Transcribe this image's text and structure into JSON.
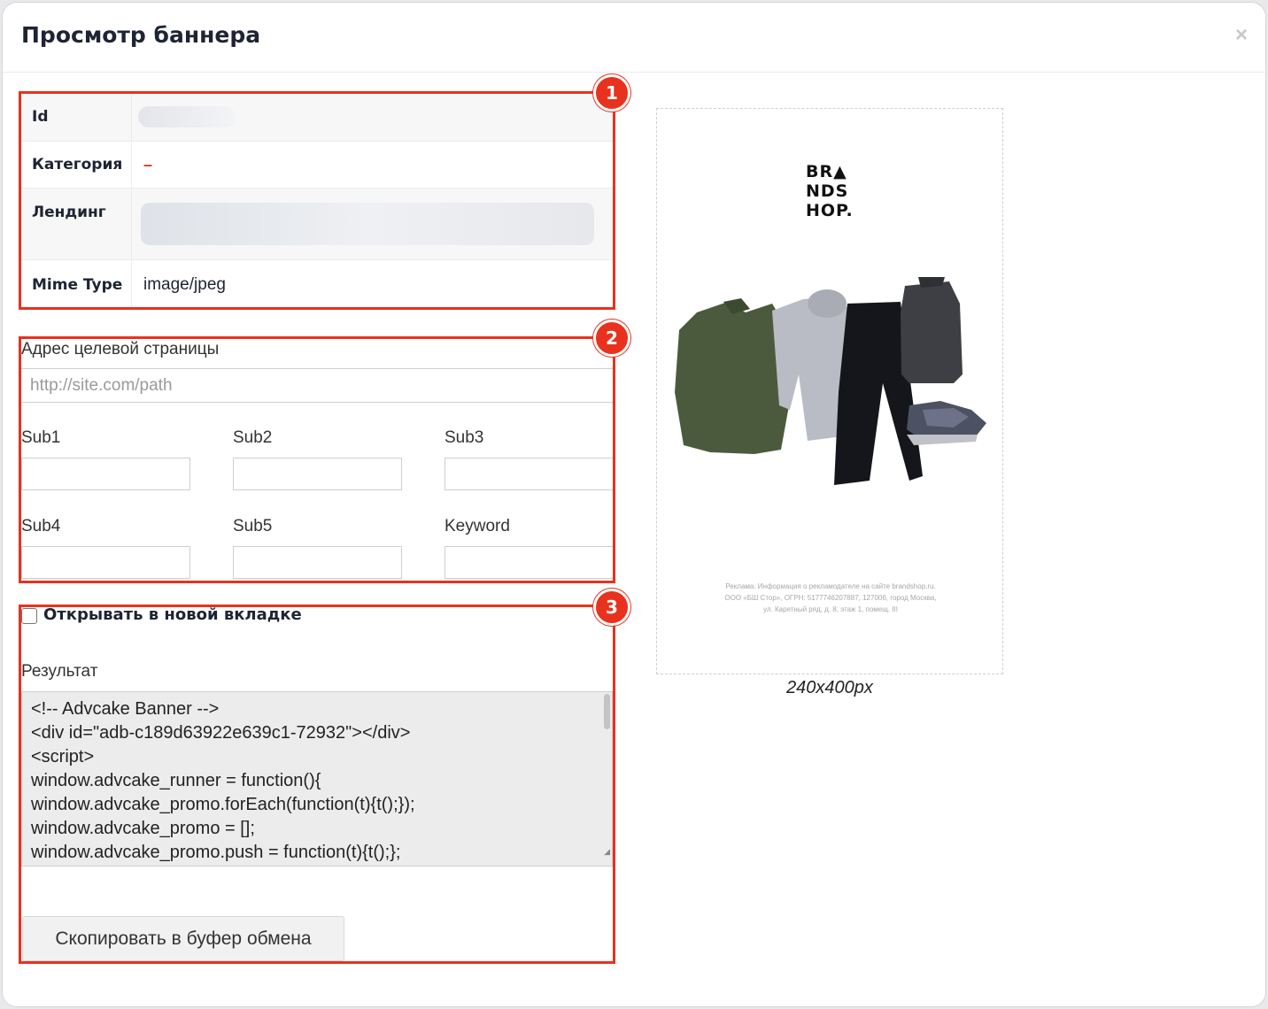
{
  "modal": {
    "title": "Просмотр баннера",
    "close_icon": "×"
  },
  "info": {
    "id_label": "Id",
    "category_label": "Категория",
    "category_value": "–",
    "landing_label": "Лендинг",
    "mime_label": "Mime Type",
    "mime_value": "image/jpeg"
  },
  "form": {
    "target_url_label": "Адрес целевой страницы",
    "target_url_placeholder": "http://site.com/path",
    "sub_labels": [
      "Sub1",
      "Sub2",
      "Sub3",
      "Sub4",
      "Sub5",
      "Keyword"
    ],
    "new_tab_label": "Открывать в новой вкладке",
    "new_tab_checked": false,
    "result_label": "Результат",
    "result_lines": [
      "<!-- Advcake Banner -->",
      "<div id=\"adb-c189d63922e639c1-72932\"></div>",
      "<script>",
      "window.advcake_runner = function(){",
      "window.advcake_promo.forEach(function(t){t();});",
      "window.advcake_promo = [];",
      "window.advcake_promo.push = function(t){t();};"
    ],
    "copy_button": "Скопировать в буфер обмена"
  },
  "annotations": [
    "1",
    "2",
    "3"
  ],
  "banner": {
    "logo_lines": [
      "BR▲",
      "NDS",
      "HOP."
    ],
    "disclaimer": "Реклама. Информация о рекламодателе на сайте brandshop.ru. ООО «БШ Стор», ОГРН: 5177746207887, 127006, город Москва, ул. Каретный ряд, д. 8, этаж 1, помещ. III",
    "size_caption": "240x400px"
  },
  "colors": {
    "annotation": "#e8321e",
    "title": "#1d2433"
  }
}
